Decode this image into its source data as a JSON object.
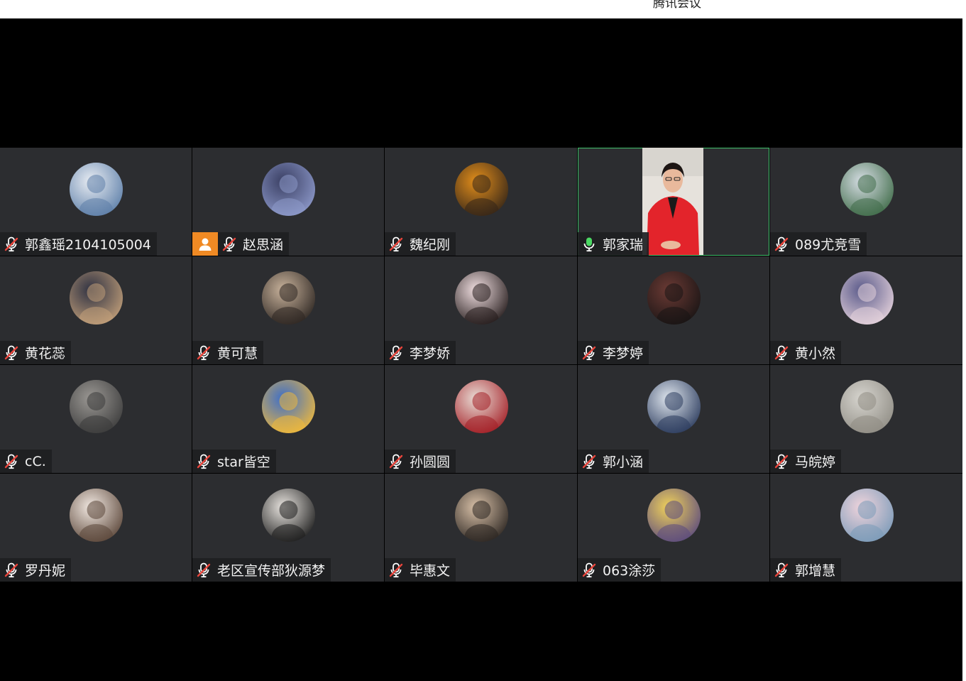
{
  "window": {
    "title": "腾讯会议"
  },
  "participants": [
    {
      "name": "郭鑫瑶2104105004",
      "mic": "muted",
      "avatar": "robot-avatar",
      "colors": [
        "#e9edf3",
        "#5c7ea8"
      ]
    },
    {
      "name": "赵思涵",
      "mic": "muted",
      "avatar": "night-figure-avatar",
      "colors": [
        "#3a3f63",
        "#8e9acb"
      ],
      "badge": "user-icon"
    },
    {
      "name": "魏纪刚",
      "mic": "muted",
      "avatar": "boy-avatar",
      "colors": [
        "#e28e1b",
        "#332418"
      ]
    },
    {
      "name": "郭家瑞",
      "mic": "active",
      "avatar": "camera-video",
      "colors": [
        "#e3242b",
        "#f1ece3"
      ],
      "speaking": true
    },
    {
      "name": "089尤竞雪",
      "mic": "muted",
      "avatar": "anime-witch-avatar",
      "colors": [
        "#d6dde4",
        "#3f6b48"
      ]
    },
    {
      "name": "黄花蕊",
      "mic": "muted",
      "avatar": "night-photo-avatar",
      "colors": [
        "#2e3142",
        "#c3a07a"
      ]
    },
    {
      "name": "黄可慧",
      "mic": "muted",
      "avatar": "girl-portrait-avatar",
      "colors": [
        "#c9b39c",
        "#2b2420"
      ]
    },
    {
      "name": "李梦娇",
      "mic": "muted",
      "avatar": "girl-selfie-avatar",
      "colors": [
        "#f1dfe1",
        "#231a1a"
      ]
    },
    {
      "name": "李梦婷",
      "mic": "muted",
      "avatar": "couple-avatar",
      "colors": [
        "#6b3a34",
        "#181414"
      ]
    },
    {
      "name": "黄小然",
      "mic": "muted",
      "avatar": "anime-girl-avatar",
      "colors": [
        "#5a5a8a",
        "#e6d3dc"
      ]
    },
    {
      "name": "cC.",
      "mic": "muted",
      "avatar": "cat-sketch-avatar",
      "colors": [
        "#9b9894",
        "#3b3b3b"
      ]
    },
    {
      "name": "star皆空",
      "mic": "muted",
      "avatar": "lotus-avatar",
      "colors": [
        "#3d6ec9",
        "#f0b93a"
      ]
    },
    {
      "name": "孙圆圆",
      "mic": "muted",
      "avatar": "red-dress-avatar",
      "colors": [
        "#e9ddd6",
        "#a31e25"
      ]
    },
    {
      "name": "郭小涵",
      "mic": "muted",
      "avatar": "ancient-lady-avatar",
      "colors": [
        "#dfe6ee",
        "#2a3a5c"
      ]
    },
    {
      "name": "马皖婷",
      "mic": "muted",
      "avatar": "dragon-coin-avatar",
      "colors": [
        "#d7d5cf",
        "#8f8c84"
      ]
    },
    {
      "name": "罗丹妮",
      "mic": "muted",
      "avatar": "baby-avatar",
      "colors": [
        "#f2e9e2",
        "#5a4538"
      ]
    },
    {
      "name": "老区宣传部狄源梦",
      "mic": "muted",
      "avatar": "laptop-cartoon-avatar",
      "colors": [
        "#e8e4df",
        "#1b1b1b"
      ]
    },
    {
      "name": "毕惠文",
      "mic": "muted",
      "avatar": "car-selfie-avatar",
      "colors": [
        "#d9c1a8",
        "#2a2420"
      ]
    },
    {
      "name": "063涂莎",
      "mic": "muted",
      "avatar": "flower-painting-avatar",
      "colors": [
        "#f1d25a",
        "#5b4a7e"
      ]
    },
    {
      "name": "郭增慧",
      "mic": "muted",
      "avatar": "anime-sketch-avatar",
      "colors": [
        "#f0d4dc",
        "#7a9ab8"
      ]
    }
  ]
}
